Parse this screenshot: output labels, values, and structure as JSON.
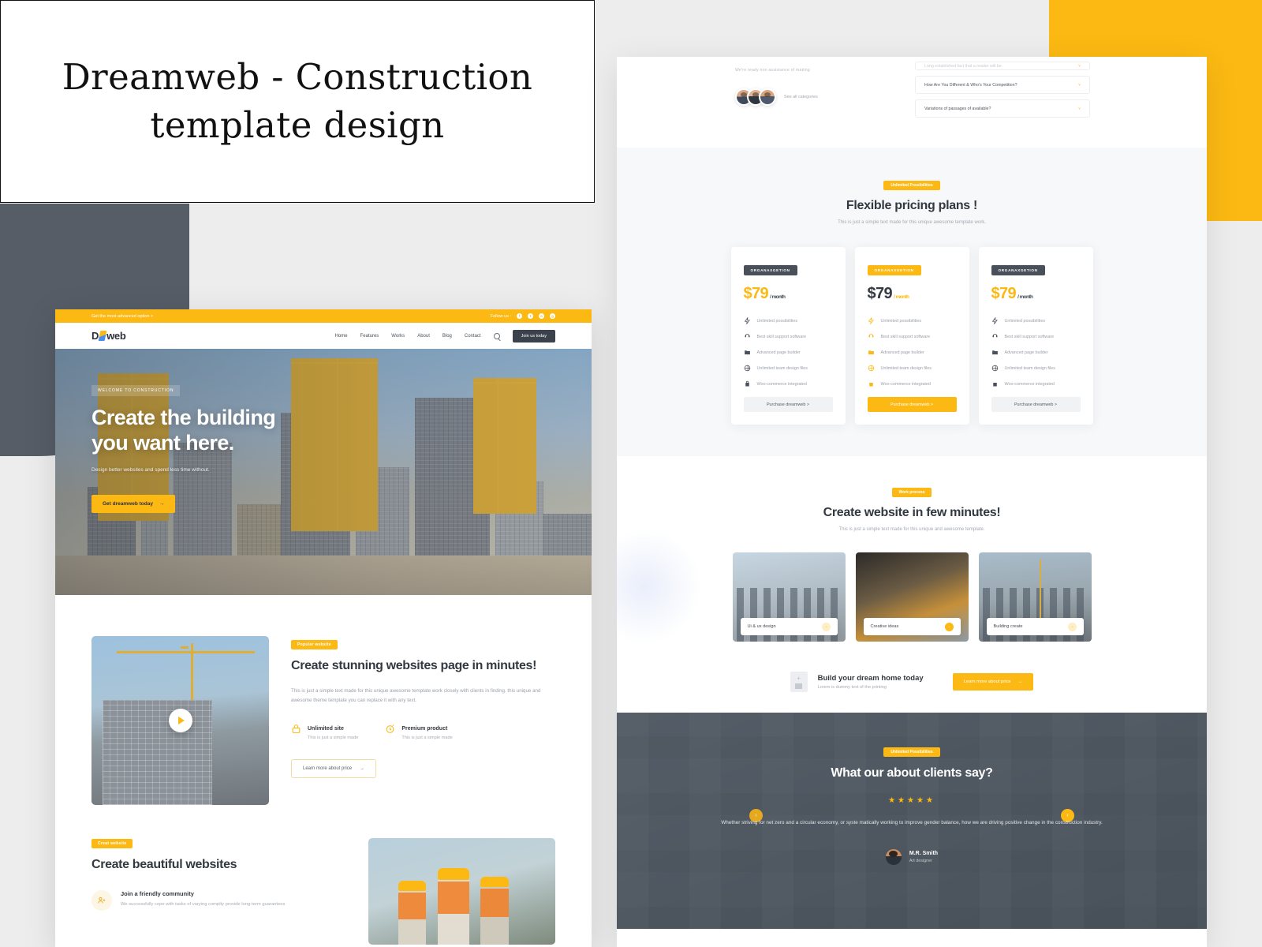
{
  "slide": {
    "title": "Dreamweb - Construction template design"
  },
  "theme": {
    "accent": "#fcb913",
    "dark": "#4e5760",
    "text": "#333940",
    "muted": "#a4aab2"
  },
  "left_mockup": {
    "topbar": {
      "promo": "Get the most advanced option  >",
      "follow_label": "Follow us :",
      "social": [
        "f",
        "t",
        "in",
        "g"
      ]
    },
    "nav": {
      "logo": "D",
      "logo_suffix": "web",
      "links": [
        "Home",
        "Features",
        "Works",
        "About",
        "Blog",
        "Contact"
      ],
      "search_icon": "search-icon",
      "cta": "Join us today"
    },
    "hero": {
      "eyebrow": "WELCOME TO CONSTRUCTION",
      "heading_line1": "Create the building",
      "heading_line2": "you want here.",
      "subtitle": "Design better websites and spend less time without.",
      "cta": "Get dreamweb today",
      "cta_arrow": "→"
    },
    "section_stunning": {
      "badge": "Popular website",
      "heading": "Create stunning websites page in minutes!",
      "paragraph": "This is just a simple text made for this unique  awesome template work closely with clients in finding. this unique and awesome theme template you can replace it with any text.",
      "features": [
        {
          "title": "Unlimited site",
          "subtitle": "This is just a simple made",
          "icon": "lock-icon"
        },
        {
          "title": "Premium product",
          "subtitle": "This is just a simple made",
          "icon": "timer-icon"
        }
      ],
      "button": "Learn more about price",
      "button_arrow": "→",
      "play_icon": "play-icon"
    },
    "section_beautiful": {
      "badge": "Creat website",
      "heading": "Create beautiful websites",
      "items": [
        {
          "title": "Join a friendly community",
          "subtitle": "We successfully cope with tasks of varying complty provide long-term guarantees",
          "icon": "user-add-icon"
        }
      ]
    }
  },
  "right_mockup": {
    "faq": {
      "cut_text": "We're ready non assistance of making",
      "see_all": "See all categories",
      "items": [
        {
          "question": "Long established fact that a reader will be",
          "state": "partial"
        },
        {
          "question": "How Are You Different & Who's Your Competition?",
          "state": "full"
        },
        {
          "question": "Variations of passages of available?",
          "state": "full"
        }
      ]
    },
    "pricing": {
      "badge": "Unlimited Possibilities",
      "heading": "Flexible pricing plans !",
      "subtitle": "This is just a simple text made for this unique  awesome template work.",
      "plans": [
        {
          "badge": "ORGANAXGETION",
          "badge_style": "dark",
          "price": "$79",
          "period": "/ month",
          "price_style": "orange",
          "features": [
            "Unlimited possibilities",
            "Best skill support software",
            "Advanced page builder",
            "Unlimited team design files",
            "Woo-commerce integrated"
          ],
          "button": "Purchase dreamweb  >",
          "button_style": "plain"
        },
        {
          "badge": "ORGANAXGETION",
          "badge_style": "yellow",
          "price": "$79",
          "period": "/ month",
          "price_style": "dark",
          "features": [
            "Unlimited possibilities",
            "Best skill support software",
            "Advanced page builder",
            "Unlimited team design files",
            "Woo-commerce integrated"
          ],
          "button": "Purchase dreamweb  >",
          "button_style": "yellow"
        },
        {
          "badge": "ORGANAXGETION",
          "badge_style": "dark",
          "price": "$79",
          "period": "/ month",
          "price_style": "orange",
          "features": [
            "Unlimited possibilities",
            "Best skill support software",
            "Advanced page builder",
            "Unlimited team design files",
            "Woo-commerce integrated"
          ],
          "button": "Purchase dreamweb  >",
          "button_style": "plain"
        }
      ]
    },
    "work_process": {
      "badge": "Work process",
      "heading": "Create website in few minutes!",
      "subtitle": "This is just a simple text made for this unique and awesome template.",
      "cards": [
        {
          "label": "Ui & ux design",
          "arrow": "→",
          "arrow_style": "pale"
        },
        {
          "label": "Creative ideas",
          "arrow": "→",
          "arrow_style": "solid"
        },
        {
          "label": "Building create",
          "arrow": "→",
          "arrow_style": "pale"
        }
      ]
    },
    "cta": {
      "title": "Build your dream home today",
      "subtitle": "Lorem is dummy text of the printing",
      "button": "Learn more about price",
      "button_arrow": "→",
      "icon": "building-plus-icon"
    },
    "testimonial": {
      "badge": "Unlimited Possibilities",
      "heading": "What our about clients say?",
      "stars": "★★★★★",
      "quote": "Whether striving for net zero and a circular economy, or syste matically working to improve gender balance, how we are driving positive change in the construction industry.",
      "author_name": "M.R. Smith",
      "author_role": "Art designer",
      "prev_arrow": "‹",
      "next_arrow": "›"
    }
  }
}
